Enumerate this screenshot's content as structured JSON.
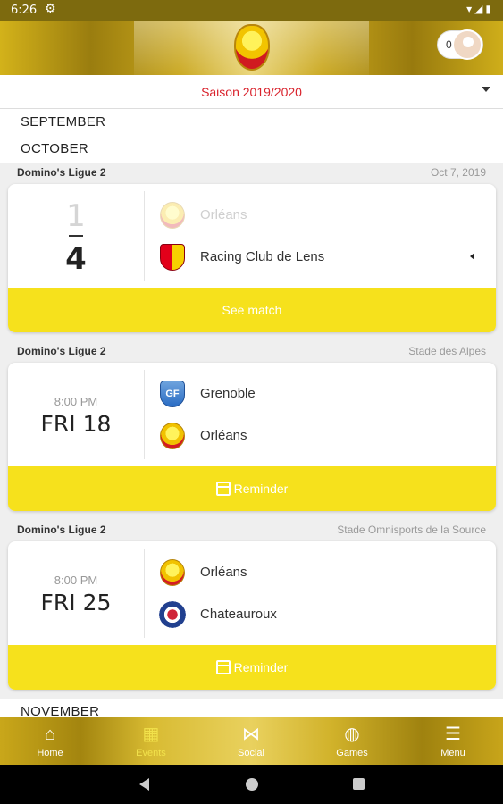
{
  "statusbar": {
    "time": "6:26"
  },
  "header": {
    "points_count": "0"
  },
  "season": {
    "label": "Saison 2019/2020"
  },
  "months": {
    "september": "SEPTEMBER",
    "october": "OCTOBER",
    "november": "NOVEMBER"
  },
  "matches": [
    {
      "league": "Domino's Ligue 2",
      "meta": "Oct 7, 2019",
      "home_score": "1",
      "away_score": "4",
      "home_team": "Orléans",
      "away_team": "Racing Club de Lens",
      "action_label": "See match"
    },
    {
      "league": "Domino's Ligue 2",
      "meta": "Stade des Alpes",
      "time": "8:00 PM",
      "day": "FRI 18",
      "home_team": "Grenoble",
      "away_team": "Orléans",
      "action_label": "Reminder"
    },
    {
      "league": "Domino's Ligue 2",
      "meta": "Stade Omnisports de la Source",
      "time": "8:00 PM",
      "day": "FRI 25",
      "home_team": "Orléans",
      "away_team": "Chateauroux",
      "action_label": "Reminder"
    }
  ],
  "bottom_nav": [
    {
      "label": "Home",
      "icon": "home-icon"
    },
    {
      "label": "Events",
      "icon": "calendar-icon"
    },
    {
      "label": "Social",
      "icon": "share-network-icon"
    },
    {
      "label": "Games",
      "icon": "gamepad-icon"
    },
    {
      "label": "Menu",
      "icon": "hamburger-menu-icon"
    }
  ],
  "colors": {
    "accent_yellow": "#f6e11c",
    "season_red": "#d9232d",
    "gold": "#c9a61b"
  }
}
